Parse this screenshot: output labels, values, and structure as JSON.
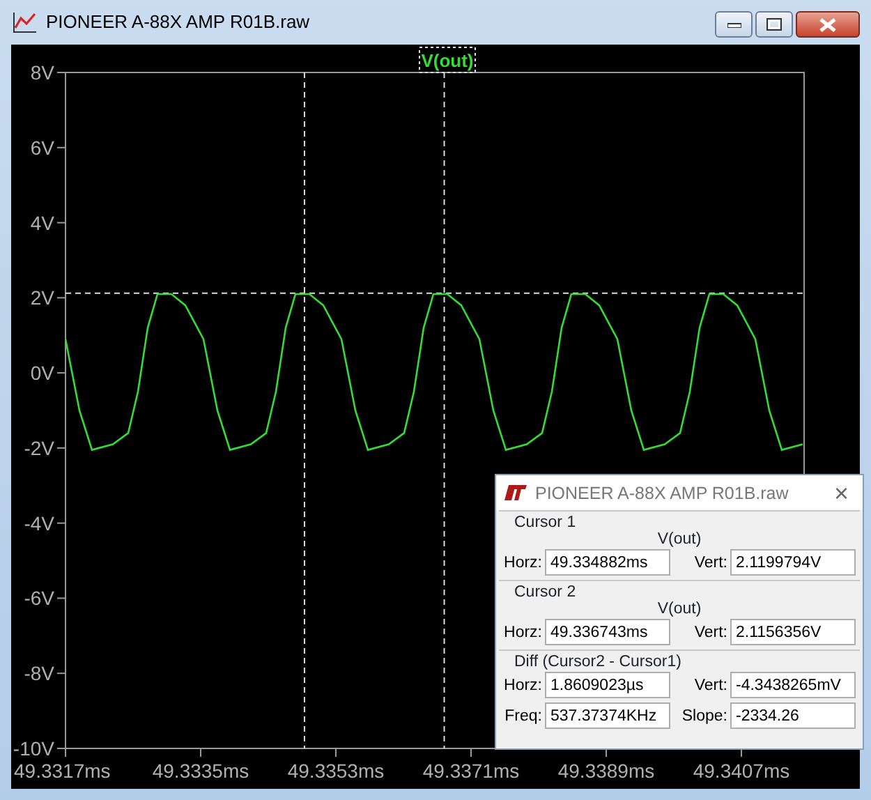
{
  "window": {
    "title": "PIONEER A-88X AMP R01B.raw"
  },
  "plot": {
    "chart_data": {
      "type": "line",
      "x": [
        49.3317,
        49.331886,
        49.332053,
        49.332331,
        49.332535,
        49.332665,
        49.332795,
        49.332925,
        49.33311,
        49.333296,
        49.333537,
        49.333723,
        49.33389,
        49.334168,
        49.334372,
        49.334502,
        49.334632,
        49.334762,
        49.334947,
        49.335133,
        49.335374,
        49.33556,
        49.335727,
        49.336005,
        49.336209,
        49.336339,
        49.336469,
        49.336599,
        49.336785,
        49.33697,
        49.337211,
        49.337397,
        49.337564,
        49.337842,
        49.338046,
        49.338176,
        49.338306,
        49.338436,
        49.338622,
        49.338807,
        49.339049,
        49.339234,
        49.339401,
        49.33968,
        49.339884,
        49.340014,
        49.340143,
        49.340273,
        49.340459,
        49.340645,
        49.340886,
        49.341072,
        49.341239,
        49.341517
      ],
      "series": [
        {
          "name": "V(out)",
          "color": "#33dd33",
          "values": [
            0.9,
            -1.0,
            -2.05,
            -1.9,
            -1.6,
            -0.5,
            1.2,
            2.1,
            2.1,
            1.8,
            0.9,
            -1.0,
            -2.05,
            -1.9,
            -1.6,
            -0.5,
            1.2,
            2.1,
            2.1,
            1.8,
            0.9,
            -1.0,
            -2.05,
            -1.9,
            -1.6,
            -0.5,
            1.2,
            2.1,
            2.1,
            1.8,
            0.9,
            -1.0,
            -2.05,
            -1.9,
            -1.6,
            -0.5,
            1.2,
            2.1,
            2.1,
            1.8,
            0.9,
            -1.0,
            -2.05,
            -1.9,
            -1.6,
            -0.5,
            1.2,
            2.1,
            2.1,
            1.8,
            0.9,
            -1.0,
            -2.05,
            -1.9
          ]
        }
      ],
      "xlim": [
        49.3317,
        49.341535
      ],
      "ylim": [
        -10,
        8
      ],
      "xticks": [
        {
          "value": 49.3317,
          "label": "49.3317ms"
        },
        {
          "value": 49.3335,
          "label": "49.3335ms"
        },
        {
          "value": 49.3353,
          "label": "49.3353ms"
        },
        {
          "value": 49.3371,
          "label": "49.3371ms"
        },
        {
          "value": 49.3389,
          "label": "49.3389ms"
        },
        {
          "value": 49.3407,
          "label": "49.3407ms"
        }
      ],
      "yticks": [
        {
          "value": 8,
          "label": "8V"
        },
        {
          "value": 6,
          "label": "6V"
        },
        {
          "value": 4,
          "label": "4V"
        },
        {
          "value": 2,
          "label": "2V"
        },
        {
          "value": 0,
          "label": "0V"
        },
        {
          "value": -2,
          "label": "-2V"
        },
        {
          "value": -4,
          "label": "-4V"
        },
        {
          "value": -6,
          "label": "-6V"
        },
        {
          "value": -8,
          "label": "-8V"
        },
        {
          "value": -10,
          "label": "-10V"
        }
      ]
    }
  },
  "cursor_dialog": {
    "title": "PIONEER A-88X AMP R01B.raw",
    "close": "×",
    "groups": [
      {
        "title": "Cursor 1",
        "trace": "V(out)",
        "fields": [
          {
            "label": "Horz:",
            "value": "49.334882ms"
          },
          {
            "label": "Vert:",
            "value": "2.1199794V"
          }
        ]
      },
      {
        "title": "Cursor 2",
        "trace": "V(out)",
        "fields": [
          {
            "label": "Horz:",
            "value": "49.336743ms"
          },
          {
            "label": "Vert:",
            "value": "2.1156356V"
          }
        ]
      },
      {
        "title": "Diff (Cursor2 - Cursor1)",
        "fields": [
          {
            "label": "Horz:",
            "value": "1.8609023µs"
          },
          {
            "label": "Vert:",
            "value": "-4.3438265mV"
          },
          {
            "label": "Freq:",
            "value": "537.37374KHz"
          },
          {
            "label": "Slope:",
            "value": "-2334.26"
          }
        ]
      }
    ]
  }
}
